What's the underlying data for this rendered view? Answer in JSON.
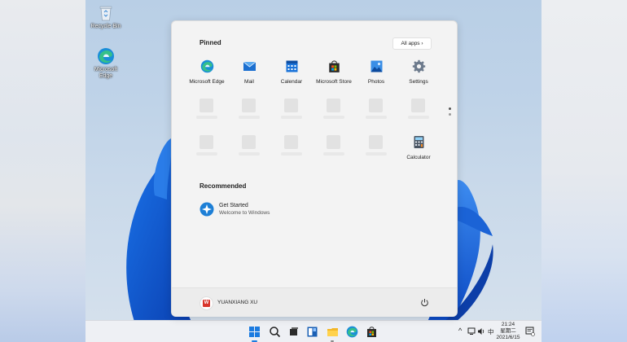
{
  "desktop": {
    "icons": [
      {
        "label": "Recycle Bin",
        "icon": "recycle-bin-icon"
      },
      {
        "label": "Microsoft Edge",
        "icon": "edge-icon"
      }
    ]
  },
  "start_menu": {
    "pinned_title": "Pinned",
    "all_apps_label": "All apps",
    "pinned": [
      {
        "label": "Microsoft Edge",
        "icon": "edge-icon"
      },
      {
        "label": "Mail",
        "icon": "mail-icon"
      },
      {
        "label": "Calendar",
        "icon": "calendar-icon"
      },
      {
        "label": "Microsoft Store",
        "icon": "store-icon"
      },
      {
        "label": "Photos",
        "icon": "photos-icon"
      },
      {
        "label": "Settings",
        "icon": "settings-icon"
      },
      {
        "label": "Calculator",
        "icon": "calculator-icon"
      }
    ],
    "recommended_title": "Recommended",
    "recommended": [
      {
        "title": "Get Started",
        "subtitle": "Welcome to Windows",
        "icon": "get-started-icon"
      }
    ],
    "user": {
      "name": "YUANXIANG XU",
      "avatar_text": "W"
    }
  },
  "taskbar": {
    "clock_time": "21:24",
    "clock_weekday": "星期二",
    "clock_date": "2021/6/15",
    "input_method": "中"
  },
  "colors": {
    "accent": "#0a64d8",
    "menu_bg": "#f3f3f3",
    "taskbar_bg": "#eef0f4"
  }
}
